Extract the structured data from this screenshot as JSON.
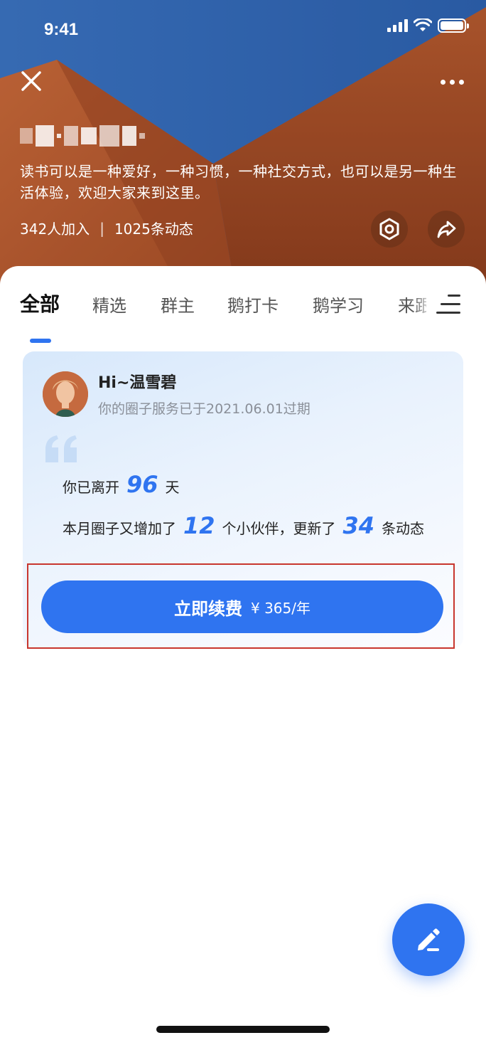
{
  "status_bar": {
    "time": "9:41"
  },
  "header": {
    "circle_description": "读书可以是一种爱好，一种习惯，一种社交方式，也可以是另一种生活体验，欢迎大家来到这里。",
    "members": "342人加入",
    "separator": "|",
    "posts": "1025条动态",
    "close_icon": "close-icon",
    "more_icon": "more-icon",
    "settings_icon": "settings-icon",
    "share_icon": "share-icon"
  },
  "tabs": [
    {
      "label": "全部",
      "active": true
    },
    {
      "label": "精选"
    },
    {
      "label": "群主"
    },
    {
      "label": "鹅打卡"
    },
    {
      "label": "鹅学习"
    },
    {
      "label": "来跟"
    }
  ],
  "renew_card": {
    "greeting": "Hi~温雪碧",
    "expire_note": "你的圈子服务已于2021.06.01过期",
    "line1_prefix": "你已离开",
    "days_away": "96",
    "line1_suffix": "天",
    "line2_prefix": "本月圈子又增加了",
    "new_members": "12",
    "line2_middle": "个小伙伴，更新了",
    "new_posts": "34",
    "line2_suffix": "条动态",
    "button_label": "立即续费",
    "button_price": "¥ 365/年"
  },
  "colors": {
    "accent": "#2f74f0",
    "highlight_border": "#c8362e",
    "hero_blue": "#3a6fb8",
    "hero_orange": "#b5582d"
  }
}
